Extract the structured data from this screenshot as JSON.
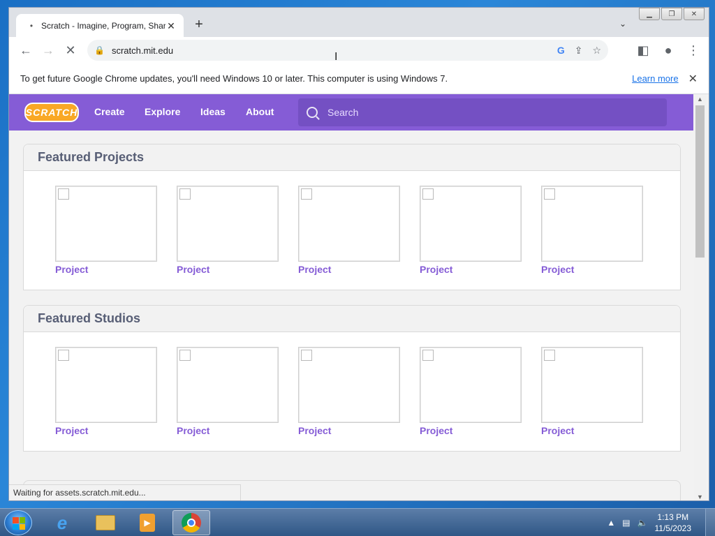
{
  "browser": {
    "tab_title": "Scratch - Imagine, Program, Share",
    "tab_favicon": "•",
    "new_tab": "+",
    "url": "scratch.mit.edu",
    "infobar": {
      "text": "To get future Google Chrome updates, you'll need Windows 10 or later. This computer is using Windows 7.",
      "link": "Learn more"
    },
    "status": "Waiting for assets.scratch.mit.edu..."
  },
  "scratch": {
    "logo": "SCRATCH",
    "nav": [
      "Create",
      "Explore",
      "Ideas",
      "About"
    ],
    "search_placeholder": "Search",
    "sections": [
      {
        "title": "Featured Projects",
        "items": [
          "Project",
          "Project",
          "Project",
          "Project",
          "Project"
        ]
      },
      {
        "title": "Featured Studios",
        "items": [
          "Project",
          "Project",
          "Project",
          "Project",
          "Project"
        ]
      }
    ],
    "accent_color": "#855cd6"
  },
  "taskbar": {
    "time": "1:13 PM",
    "date": "11/5/2023",
    "apps": [
      "internet-explorer-icon",
      "file-explorer-icon",
      "media-player-icon",
      "chrome-icon"
    ]
  }
}
